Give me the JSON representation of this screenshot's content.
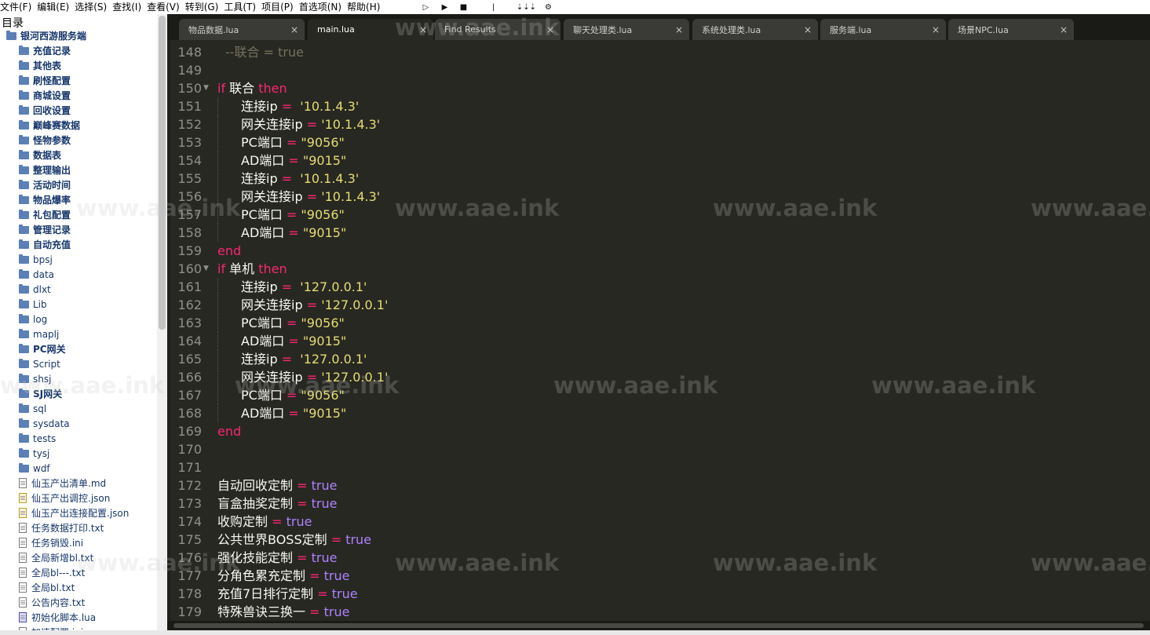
{
  "menubar": {
    "items": [
      "文件(F)",
      "编辑(E)",
      "选择(S)",
      "查找(I)",
      "查看(V)",
      "转到(G)",
      "工具(T)",
      "项目(P)",
      "首选项(N)",
      "帮助(H)"
    ],
    "tools": [
      "play-icon",
      "run-icon",
      "stop-icon",
      "separator-icon",
      "sort-icon",
      "settings-icon"
    ]
  },
  "sidebar": {
    "title": "目录",
    "root": "银河西游服务端",
    "folders": [
      "充值记录",
      "其他表",
      "刷怪配置",
      "商城设置",
      "回收设置",
      "巅峰赛数据",
      "怪物参数",
      "数据表",
      "整理输出",
      "活动时间",
      "物品爆率",
      "礼包配置",
      "管理记录",
      "自动充值",
      "bpsj",
      "data",
      "dlxt",
      "Lib",
      "log",
      "maplj",
      "PC网关",
      "Script",
      "shsj",
      "SJ网关",
      "sql",
      "sysdata",
      "tests",
      "tysj",
      "wdf"
    ],
    "files": [
      {
        "name": "仙玉产出清单.md",
        "type": "md"
      },
      {
        "name": "仙玉产出调控.json",
        "type": "json"
      },
      {
        "name": "仙玉产出连接配置.json",
        "type": "json"
      },
      {
        "name": "任务数据打印.txt",
        "type": "txt"
      },
      {
        "name": "任务销毁.ini",
        "type": "ini"
      },
      {
        "name": "全局新增bl.txt",
        "type": "txt"
      },
      {
        "name": "全局bl---.txt",
        "type": "txt"
      },
      {
        "name": "全局bl.txt",
        "type": "txt"
      },
      {
        "name": "公告内容.txt",
        "type": "txt"
      },
      {
        "name": "初始化脚本.lua",
        "type": "lua"
      },
      {
        "name": "加速配置.ini",
        "type": "ini"
      }
    ]
  },
  "tabs": [
    {
      "label": "物品数据.lua",
      "active": false
    },
    {
      "label": "main.lua",
      "active": true
    },
    {
      "label": "Find Results",
      "active": false
    },
    {
      "label": "聊天处理类.lua",
      "active": false
    },
    {
      "label": "系统处理类.lua",
      "active": false
    },
    {
      "label": "服务端.lua",
      "active": false
    },
    {
      "label": "场景NPC.lua",
      "active": false
    }
  ],
  "tab_close_glyph": "×",
  "editor": {
    "lines": [
      {
        "n": "148",
        "indent": 0,
        "tokens": [
          [
            "cmt",
            "--联合 = true"
          ]
        ]
      },
      {
        "n": "149",
        "indent": 0,
        "tokens": []
      },
      {
        "n": "150",
        "indent": 0,
        "fold": true,
        "tokens": [
          [
            "kw",
            "if "
          ],
          [
            "id",
            "联合 "
          ],
          [
            "kw",
            "then"
          ]
        ]
      },
      {
        "n": "151",
        "indent": 1,
        "tokens": [
          [
            "id",
            "连接ip "
          ],
          [
            "op",
            "= "
          ],
          [
            "str",
            " '10.1.4.3'"
          ]
        ]
      },
      {
        "n": "152",
        "indent": 1,
        "tokens": [
          [
            "id",
            "网关连接ip "
          ],
          [
            "op",
            "= "
          ],
          [
            "str",
            "'10.1.4.3'"
          ]
        ]
      },
      {
        "n": "153",
        "indent": 1,
        "tokens": [
          [
            "id",
            "PC端口 "
          ],
          [
            "op",
            "= "
          ],
          [
            "str",
            "\"9056\""
          ]
        ]
      },
      {
        "n": "154",
        "indent": 1,
        "tokens": [
          [
            "id",
            "AD端口 "
          ],
          [
            "op",
            "= "
          ],
          [
            "str",
            "\"9015\""
          ]
        ]
      },
      {
        "n": "155",
        "indent": 1,
        "tokens": [
          [
            "id",
            "连接ip "
          ],
          [
            "op",
            "= "
          ],
          [
            "str",
            " '10.1.4.3'"
          ]
        ]
      },
      {
        "n": "156",
        "indent": 1,
        "tokens": [
          [
            "id",
            "网关连接ip "
          ],
          [
            "op",
            "= "
          ],
          [
            "str",
            "'10.1.4.3'"
          ]
        ]
      },
      {
        "n": "157",
        "indent": 1,
        "tokens": [
          [
            "id",
            "PC端口 "
          ],
          [
            "op",
            "= "
          ],
          [
            "str",
            "\"9056\""
          ]
        ]
      },
      {
        "n": "158",
        "indent": 1,
        "tokens": [
          [
            "id",
            "AD端口 "
          ],
          [
            "op",
            "= "
          ],
          [
            "str",
            "\"9015\""
          ]
        ]
      },
      {
        "n": "159",
        "indent": 0,
        "tokens": [
          [
            "kw",
            "end"
          ]
        ]
      },
      {
        "n": "160",
        "indent": 0,
        "fold": true,
        "tokens": [
          [
            "kw",
            "if "
          ],
          [
            "id",
            "单机 "
          ],
          [
            "kw",
            "then"
          ]
        ]
      },
      {
        "n": "161",
        "indent": 1,
        "tokens": [
          [
            "id",
            "连接ip "
          ],
          [
            "op",
            "= "
          ],
          [
            "str",
            " '127.0.0.1'"
          ]
        ]
      },
      {
        "n": "162",
        "indent": 1,
        "tokens": [
          [
            "id",
            "网关连接ip "
          ],
          [
            "op",
            "= "
          ],
          [
            "str",
            "'127.0.0.1'"
          ]
        ]
      },
      {
        "n": "163",
        "indent": 1,
        "tokens": [
          [
            "id",
            "PC端口 "
          ],
          [
            "op",
            "= "
          ],
          [
            "str",
            "\"9056\""
          ]
        ]
      },
      {
        "n": "164",
        "indent": 1,
        "tokens": [
          [
            "id",
            "AD端口 "
          ],
          [
            "op",
            "= "
          ],
          [
            "str",
            "\"9015\""
          ]
        ]
      },
      {
        "n": "165",
        "indent": 1,
        "tokens": [
          [
            "id",
            "连接ip "
          ],
          [
            "op",
            "= "
          ],
          [
            "str",
            " '127.0.0.1'"
          ]
        ]
      },
      {
        "n": "166",
        "indent": 1,
        "tokens": [
          [
            "id",
            "网关连接ip "
          ],
          [
            "op",
            "= "
          ],
          [
            "str",
            "'127.0.0.1'"
          ]
        ]
      },
      {
        "n": "167",
        "indent": 1,
        "tokens": [
          [
            "id",
            "PC端口 "
          ],
          [
            "op",
            "= "
          ],
          [
            "str",
            "\"9056\""
          ]
        ]
      },
      {
        "n": "168",
        "indent": 1,
        "tokens": [
          [
            "id",
            "AD端口 "
          ],
          [
            "op",
            "= "
          ],
          [
            "str",
            "\"9015\""
          ]
        ]
      },
      {
        "n": "169",
        "indent": 0,
        "tokens": [
          [
            "kw",
            "end"
          ]
        ]
      },
      {
        "n": "170",
        "indent": 0,
        "tokens": []
      },
      {
        "n": "171",
        "indent": 0,
        "tokens": []
      },
      {
        "n": "172",
        "indent": 0,
        "tokens": [
          [
            "id",
            "自动回收定制 "
          ],
          [
            "op",
            "= "
          ],
          [
            "bool",
            "true"
          ]
        ]
      },
      {
        "n": "173",
        "indent": 0,
        "tokens": [
          [
            "id",
            "盲盒抽奖定制 "
          ],
          [
            "op",
            "= "
          ],
          [
            "bool",
            "true"
          ]
        ]
      },
      {
        "n": "174",
        "indent": 0,
        "tokens": [
          [
            "id",
            "收购定制 "
          ],
          [
            "op",
            "= "
          ],
          [
            "bool",
            "true"
          ]
        ]
      },
      {
        "n": "175",
        "indent": 0,
        "tokens": [
          [
            "id",
            "公共世界BOSS定制 "
          ],
          [
            "op",
            "= "
          ],
          [
            "bool",
            "true"
          ]
        ]
      },
      {
        "n": "176",
        "indent": 0,
        "tokens": [
          [
            "id",
            "强化技能定制 "
          ],
          [
            "op",
            "= "
          ],
          [
            "bool",
            "true"
          ]
        ]
      },
      {
        "n": "177",
        "indent": 0,
        "tokens": [
          [
            "id",
            "分角色累充定制 "
          ],
          [
            "op",
            "= "
          ],
          [
            "bool",
            "true"
          ]
        ]
      },
      {
        "n": "178",
        "indent": 0,
        "tokens": [
          [
            "id",
            "充值7日排行定制 "
          ],
          [
            "op",
            "= "
          ],
          [
            "bool",
            "true"
          ]
        ]
      },
      {
        "n": "179",
        "indent": 0,
        "tokens": [
          [
            "id",
            "特殊兽诀三换一 "
          ],
          [
            "op",
            "= "
          ],
          [
            "bool",
            "true"
          ]
        ]
      }
    ]
  },
  "watermark": "www.aae.ink"
}
